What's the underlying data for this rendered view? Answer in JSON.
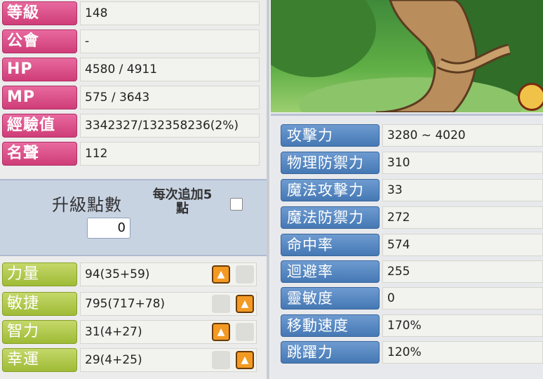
{
  "basic": [
    {
      "label": "等級",
      "value": "148"
    },
    {
      "label": "公會",
      "value": "-"
    },
    {
      "label": "HP",
      "value": "4580 / 4911"
    },
    {
      "label": "MP",
      "value": "575 / 3643"
    },
    {
      "label": "經驗值",
      "value": "3342327/132358236(2%)"
    },
    {
      "label": "名聲",
      "value": "112"
    }
  ],
  "ap": {
    "title": "升級點數",
    "value": "0",
    "every_label": "每次追加5\n點"
  },
  "stats": [
    {
      "label": "力量",
      "value": "94(35+59)"
    },
    {
      "label": "敏捷",
      "value": "795(717+78)"
    },
    {
      "label": "智力",
      "value": "31(4+27)"
    },
    {
      "label": "幸運",
      "value": "29(4+25)"
    }
  ],
  "combat": [
    {
      "label": "攻擊力",
      "value": "3280 ~ 4020"
    },
    {
      "label": "物理防禦力",
      "value": "310"
    },
    {
      "label": "魔法攻擊力",
      "value": "33"
    },
    {
      "label": "魔法防禦力",
      "value": "272"
    },
    {
      "label": "命中率",
      "value": "574"
    },
    {
      "label": "迴避率",
      "value": "255"
    },
    {
      "label": "靈敏度",
      "value": "0"
    },
    {
      "label": "移動速度",
      "value": "170%"
    },
    {
      "label": "跳躍力",
      "value": "120%"
    }
  ],
  "colors": {
    "pink": "#d9467f",
    "green": "#a8c33e",
    "blue": "#4f82bf",
    "accent": "#f39a23"
  }
}
